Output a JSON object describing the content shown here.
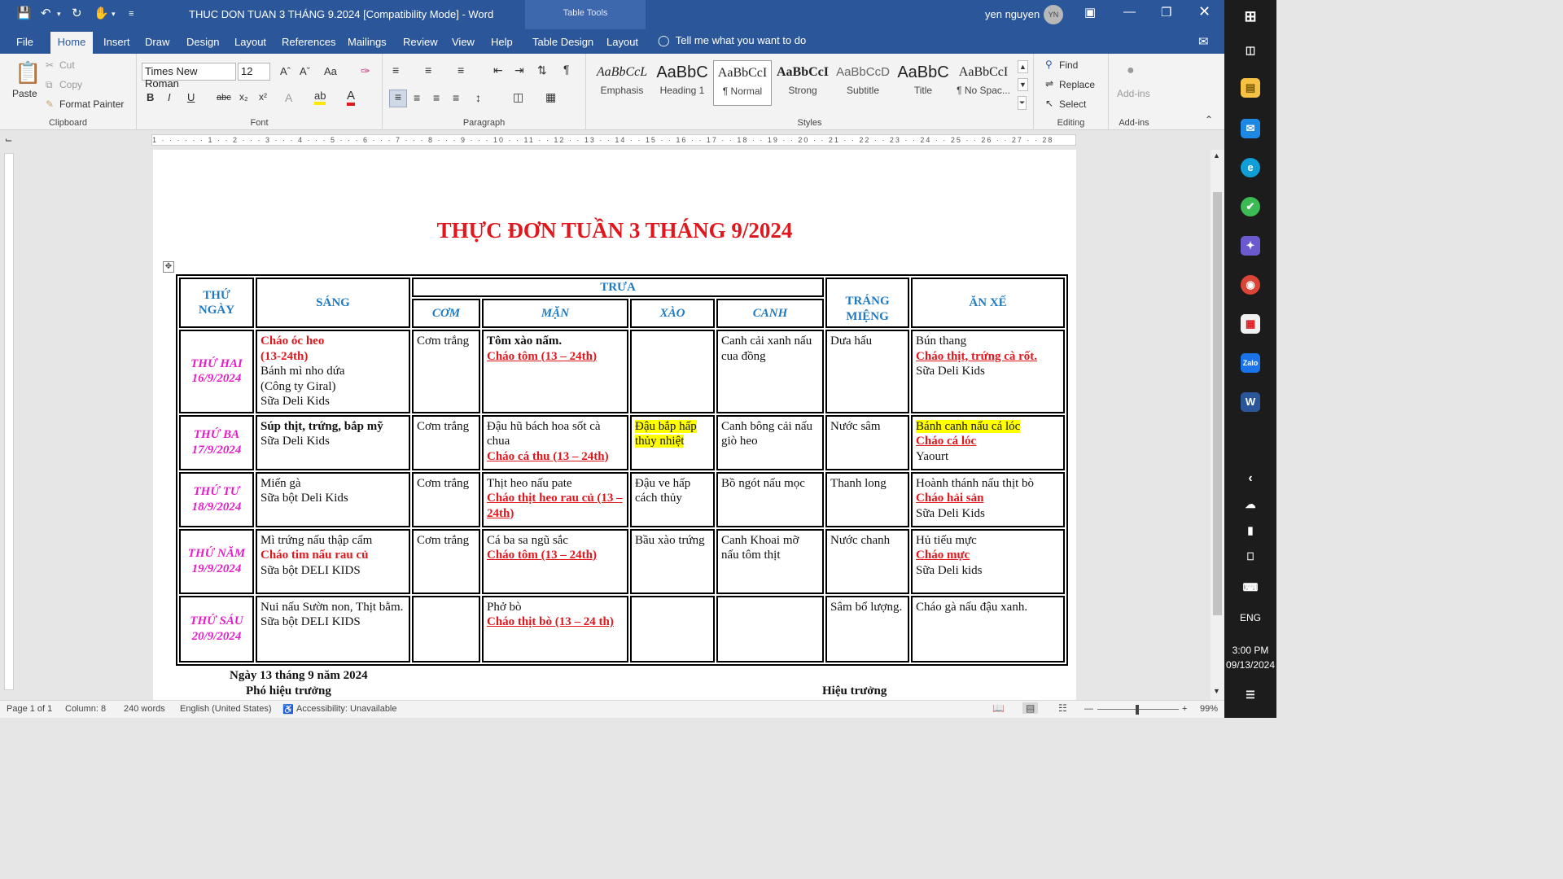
{
  "window": {
    "title": "THUC DON TUAN 3 THÁNG 9.2024 [Compatibility Mode]  -  Word",
    "context_tab": "Table Tools",
    "user_name": "yen nguyen",
    "user_initials": "YN"
  },
  "menu_tabs": [
    "File",
    "Home",
    "Insert",
    "Draw",
    "Design",
    "Layout",
    "References",
    "Mailings",
    "Review",
    "View",
    "Help",
    "Table Design",
    "Layout"
  ],
  "tell_me": "Tell me what you want to do",
  "ribbon": {
    "clipboard": {
      "paste": "Paste",
      "cut": "Cut",
      "copy": "Copy",
      "format_painter": "Format Painter",
      "label": "Clipboard"
    },
    "font": {
      "name": "Times New Roman",
      "size": "12",
      "label": "Font"
    },
    "paragraph": {
      "label": "Paragraph"
    },
    "styles": {
      "label": "Styles",
      "items": [
        {
          "preview": "AaBbCcL",
          "name": "Emphasis"
        },
        {
          "preview": "AaBbC",
          "name": "Heading 1"
        },
        {
          "preview": "AaBbCcI",
          "name": "¶ Normal"
        },
        {
          "preview": "AaBbCcI",
          "name": "Strong"
        },
        {
          "preview": "AaBbCcD",
          "name": "Subtitle"
        },
        {
          "preview": "AaBbC",
          "name": "Title"
        },
        {
          "preview": "AaBbCcI",
          "name": "¶ No Spac..."
        }
      ]
    },
    "editing": {
      "find": "Find",
      "replace": "Replace",
      "select": "Select",
      "label": "Editing"
    },
    "addins": {
      "button": "Add-ins",
      "label": "Add-ins"
    }
  },
  "ruler": {
    "numbers": "1 · · · · · · 1 · · 2 · · · 3 · · · 4 · · · 5 · · · 6 · · · 7 · · · 8 · · · 9 · · · 10 · · 11 · · 12 · · 13 · · 14 · · 15 · · 16 · · 17 · · 18 · · 19 · · 20 · · 21 · · 22 · · 23 · · 24 · · 25 · · 26 · · 27 · · 28"
  },
  "document": {
    "title": "THỰC ĐƠN TUẦN 3 THÁNG 9/2024",
    "headers": {
      "day": [
        "THỨ",
        "NGÀY"
      ],
      "breakfast": "SÁNG",
      "lunch": "TRƯA",
      "lunch_sub": [
        "CƠM",
        "MẶN",
        "XÀO",
        "CANH"
      ],
      "dessert": [
        "TRÁNG",
        "MIỆNG"
      ],
      "snack": "ĂN XẾ"
    },
    "rows": [
      {
        "day": "THỨ HAI",
        "date": "16/9/2024",
        "breakfast": [
          {
            "text": "Cháo óc heo",
            "style": "red"
          },
          {
            "text": "(13-24th)",
            "style": "red"
          },
          {
            "text": "Bánh mì nho dứa",
            "style": ""
          },
          {
            "text": "(Công ty Giral)",
            "style": ""
          },
          {
            "text": "Sữa Deli Kids",
            "style": ""
          }
        ],
        "com": "Cơm trắng",
        "man": [
          {
            "text": "Tôm xào nấm.",
            "style": "bold"
          },
          {
            "text": "Cháo tôm (13 – 24th)",
            "style": "redu"
          }
        ],
        "xao": [],
        "canh": [
          {
            "text": "Canh cải xanh nấu cua đồng",
            "style": ""
          }
        ],
        "trang_mieng": "Dưa hấu",
        "an_xe": [
          {
            "text": "Bún thang",
            "style": ""
          },
          {
            "text": "Cháo thịt, trứng cà rốt.",
            "style": "redu"
          },
          {
            "text": "Sữa Deli Kids",
            "style": ""
          }
        ]
      },
      {
        "day": "THỨ BA",
        "date": "17/9/2024",
        "breakfast": [
          {
            "text": "Súp thịt, trứng, bắp mỹ",
            "style": "bold"
          },
          {
            "text": "Sữa Deli Kids",
            "style": ""
          }
        ],
        "com": "Cơm trắng",
        "man": [
          {
            "text": "Đậu hũ bách hoa sốt cà chua",
            "style": ""
          },
          {
            "text": "Cháo cá thu (13 – 24th)",
            "style": "redu"
          }
        ],
        "xao": [
          {
            "text": "Đậu bắp hấp thủy nhiệt",
            "style": "hl"
          }
        ],
        "canh": [
          {
            "text": "Canh bông cải nấu giò heo",
            "style": ""
          }
        ],
        "trang_mieng": "Nước sâm",
        "an_xe": [
          {
            "text": "Bánh canh nấu cá lóc",
            "style": "hl"
          },
          {
            "text": "Cháo cá lóc",
            "style": "redu"
          },
          {
            "text": "Yaourt",
            "style": ""
          }
        ]
      },
      {
        "day": "THỨ TƯ",
        "date": "18/9/2024",
        "breakfast": [
          {
            "text": "Miến gà",
            "style": ""
          },
          {
            "text": "Sữa bột Deli Kids",
            "style": ""
          }
        ],
        "com": "Cơm trắng",
        "man": [
          {
            "text": "Thịt heo nấu pate",
            "style": ""
          },
          {
            "text": "Cháo thịt heo rau củ (13 – 24th)",
            "style": "redu"
          }
        ],
        "xao": [
          {
            "text": "Đậu ve hấp cách thủy",
            "style": ""
          }
        ],
        "canh": [
          {
            "text": "Bồ ngót nấu mọc",
            "style": ""
          }
        ],
        "trang_mieng": "Thanh long",
        "an_xe": [
          {
            "text": "Hoành thánh nấu thịt bò",
            "style": ""
          },
          {
            "text": "Cháo hải sản",
            "style": "redu"
          },
          {
            "text": "Sữa Deli Kids",
            "style": ""
          }
        ]
      },
      {
        "day": "THỨ NĂM",
        "date": "19/9/2024",
        "breakfast": [
          {
            "text": "Mì trứng nấu thập cẩm",
            "style": ""
          },
          {
            "text": "Cháo tim nấu rau củ",
            "style": "red"
          },
          {
            "text": "Sữa bột DELI KIDS",
            "style": ""
          }
        ],
        "com": "Cơm trắng",
        "man": [
          {
            "text": "Cá ba sa ngũ sắc",
            "style": ""
          },
          {
            "text": "Cháo tôm (13 – 24th)",
            "style": "redu"
          }
        ],
        "xao": [
          {
            "text": "Bầu xào trứng",
            "style": ""
          }
        ],
        "canh": [
          {
            "text": "Canh Khoai mỡ nấu tôm thịt",
            "style": ""
          }
        ],
        "trang_mieng": "Nước chanh",
        "an_xe": [
          {
            "text": "Hủ tiếu mực",
            "style": ""
          },
          {
            "text": "Cháo mực",
            "style": "redu"
          },
          {
            "text": "Sữa Deli kids",
            "style": ""
          }
        ]
      },
      {
        "day": "THỨ SÁU",
        "date": "20/9/2024",
        "breakfast": [
          {
            "text": "Nui nấu Sườn non, Thịt bằm.",
            "style": ""
          },
          {
            "text": "Sữa bột DELI KIDS",
            "style": ""
          }
        ],
        "com": "",
        "man": [
          {
            "text": "Phở bò",
            "style": ""
          },
          {
            "text": "Cháo thịt bò (13 – 24 th)",
            "style": "redu"
          }
        ],
        "xao": [],
        "canh": [],
        "trang_mieng": "Sâm bổ lượng.",
        "an_xe": [
          {
            "text": "Cháo gà nấu đậu xanh.",
            "style": ""
          }
        ]
      }
    ],
    "date_line": "Ngày 13 tháng 9 năm 2024",
    "vice_principal": "Phó hiệu trưởng",
    "principal": "Hiệu trưởng"
  },
  "status": {
    "page": "Page 1 of 1",
    "column": "Column: 8",
    "words": "240 words",
    "language": "English (United States)",
    "accessibility": "Accessibility: Unavailable",
    "zoom": "99%"
  },
  "taskbar": {
    "language": "ENG",
    "time": "3:00 PM",
    "date": "09/13/2024"
  }
}
